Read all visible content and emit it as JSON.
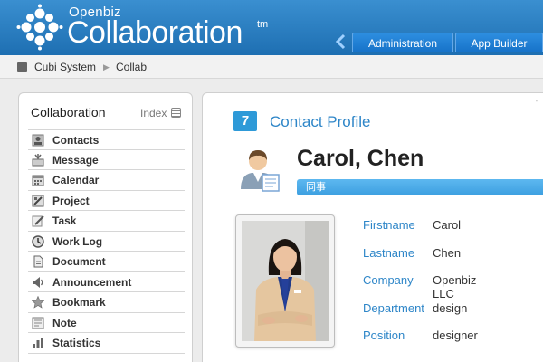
{
  "header": {
    "brand_small": "Openbiz",
    "brand_big": "Collaboration",
    "brand_tm": "tm",
    "tabs": [
      {
        "label": "Administration"
      },
      {
        "label": "App Builder"
      }
    ]
  },
  "breadcrumb": {
    "items": [
      {
        "label": "Cubi System"
      },
      {
        "label": "Collab"
      }
    ]
  },
  "sidebar": {
    "title": "Collaboration",
    "index_label": "Index",
    "items": [
      {
        "label": "Contacts",
        "icon": "contacts-icon"
      },
      {
        "label": "Message",
        "icon": "message-icon"
      },
      {
        "label": "Calendar",
        "icon": "calendar-icon"
      },
      {
        "label": "Project",
        "icon": "project-icon"
      },
      {
        "label": "Task",
        "icon": "task-icon"
      },
      {
        "label": "Work Log",
        "icon": "worklog-icon"
      },
      {
        "label": "Document",
        "icon": "document-icon"
      },
      {
        "label": "Announcement",
        "icon": "announcement-icon"
      },
      {
        "label": "Bookmark",
        "icon": "bookmark-icon"
      },
      {
        "label": "Note",
        "icon": "note-icon"
      },
      {
        "label": "Statistics",
        "icon": "statistics-icon"
      }
    ]
  },
  "main": {
    "section_number": "7",
    "section_title": "Contact Profile",
    "corner_mark": "'",
    "contact_name": "Carol, Chen",
    "tag": "同事",
    "fields": [
      {
        "label": "Firstname",
        "value": "Carol"
      },
      {
        "label": "Lastname",
        "value": "Chen"
      },
      {
        "label": "Company",
        "value": "Openbiz LLC"
      },
      {
        "label": "Department",
        "value": "design"
      },
      {
        "label": "Position",
        "value": "designer"
      }
    ]
  },
  "colors": {
    "header_blue": "#1e6fb2",
    "accent_blue": "#2e86c8",
    "tag_blue": "#4aaae6"
  }
}
